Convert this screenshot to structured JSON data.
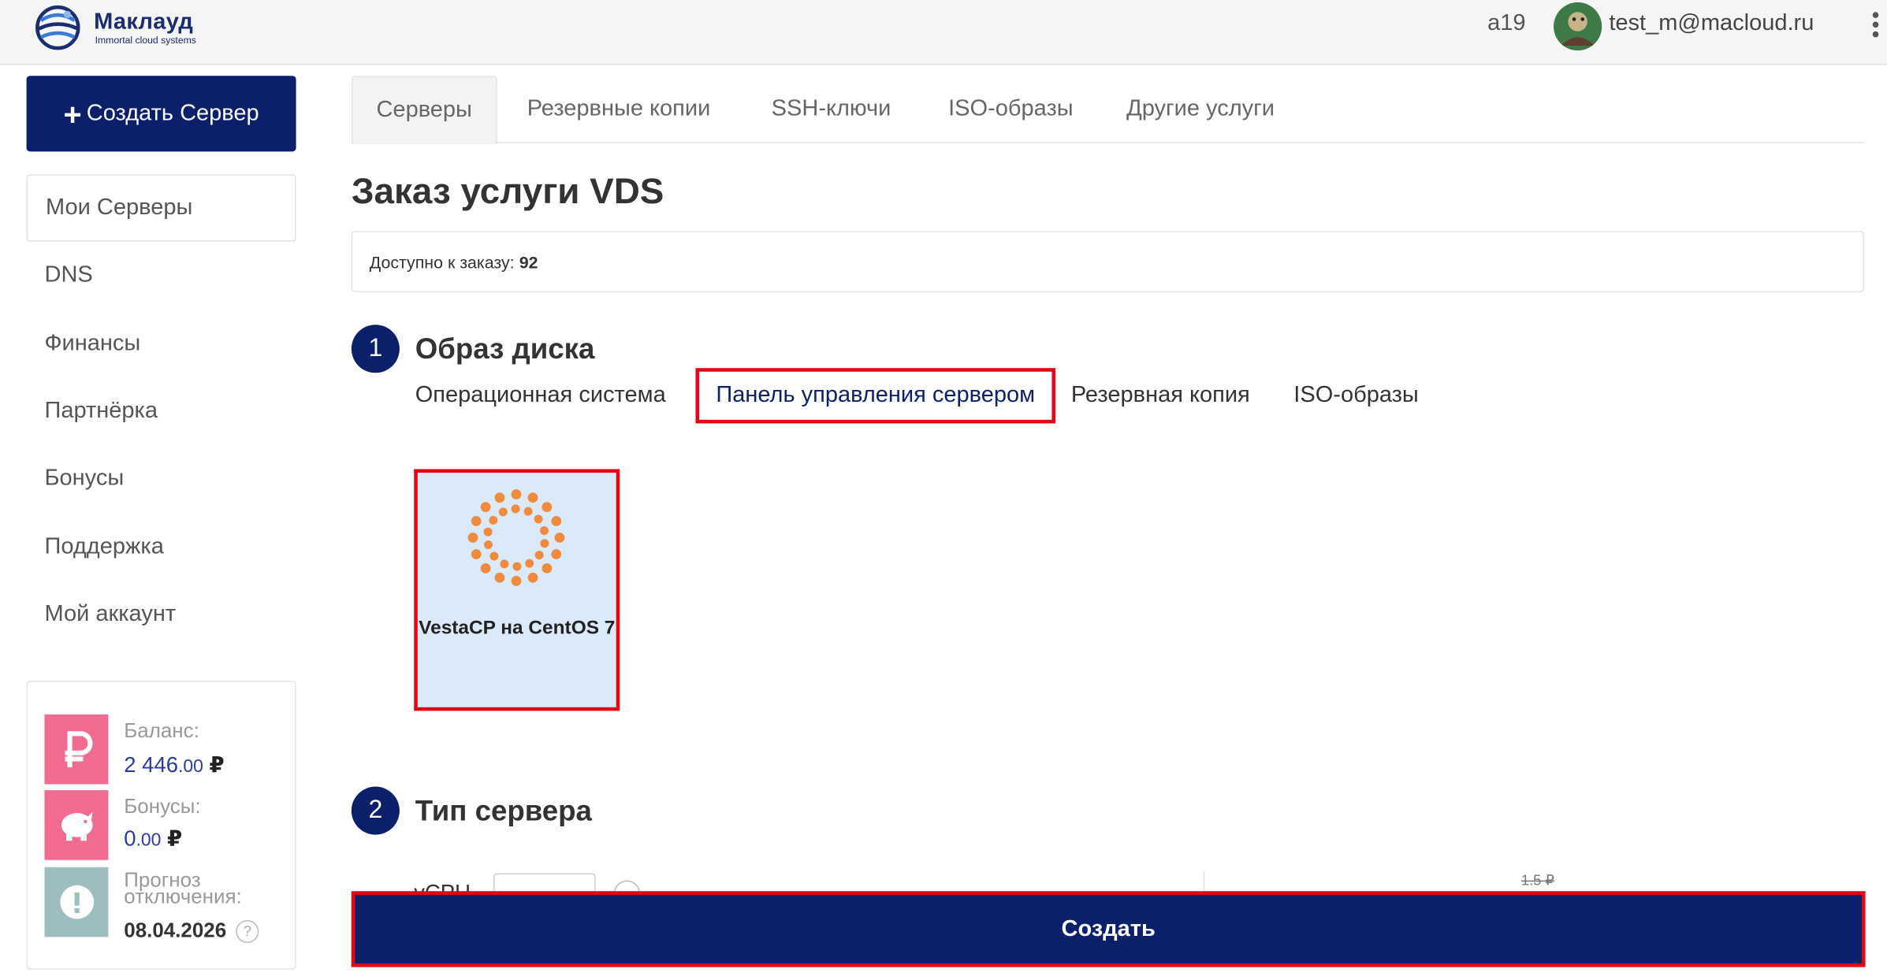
{
  "header": {
    "logo_name": "Маклауд",
    "logo_tagline": "Immortal cloud systems",
    "user_id": "a19",
    "email": "test_m@macloud.ru"
  },
  "sidebar": {
    "create_button": "Создать Сервер",
    "items": [
      {
        "label": "Мои Серверы",
        "active": true
      },
      {
        "label": "DNS"
      },
      {
        "label": "Финансы"
      },
      {
        "label": "Партнёрка"
      },
      {
        "label": "Бонусы"
      },
      {
        "label": "Поддержка"
      },
      {
        "label": "Мой аккаунт"
      }
    ],
    "balance": {
      "label": "Баланс:",
      "int": "2 446",
      "frac": ".00",
      "currency": "₽"
    },
    "bonuses": {
      "label": "Бонусы:",
      "int": "0",
      "frac": ".00",
      "currency": "₽"
    },
    "forecast": {
      "label": "Прогноз отключения:",
      "date": "08.04.2026",
      "help": "?"
    }
  },
  "tabs": [
    {
      "label": "Серверы",
      "active": true
    },
    {
      "label": "Резервные копии"
    },
    {
      "label": "SSH-ключи"
    },
    {
      "label": "ISO-образы"
    },
    {
      "label": "Другие услуги"
    }
  ],
  "main": {
    "title": "Заказ услуги VDS",
    "available_label": "Доступно к заказу:",
    "available_count": "92",
    "step1": {
      "num": "1",
      "title": "Образ диска",
      "subtabs": [
        {
          "label": "Операционная система"
        },
        {
          "label": "Панель управления сервером",
          "selected": true
        },
        {
          "label": "Резервная копия"
        },
        {
          "label": "ISO-образы"
        }
      ],
      "card": {
        "name": "VestaCP на CentOS 7",
        "icon": "vestacp-logo-icon",
        "color": "#f08a3c"
      }
    },
    "step2": {
      "num": "2",
      "title": "Тип сервера",
      "partial_label": "vCPU",
      "partial_price": "1.5 ₽"
    },
    "submit_label": "Создать"
  },
  "colors": {
    "brand_navy": "#0c1f6b",
    "highlight_red": "#e30613",
    "card_bg": "#dbeafb",
    "balance_icon_bg": "#f06b8f",
    "forecast_icon_bg": "#9dbdbf"
  }
}
